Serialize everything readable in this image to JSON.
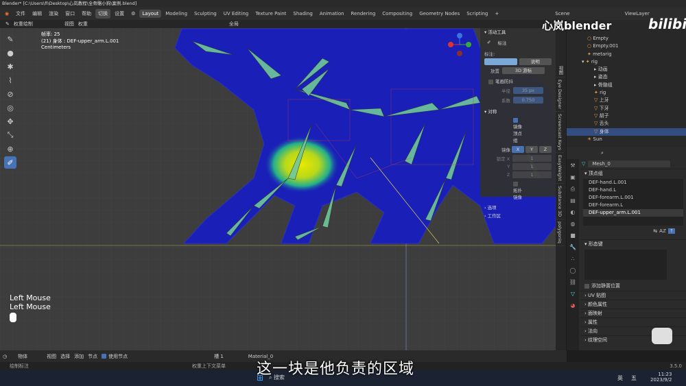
{
  "window": {
    "title": "Blender* [C:\\Users\\fi\\Desktop\\心岚教程\\全骨骼小狗\\案例.blend]"
  },
  "menu": {
    "items": [
      "文件",
      "编辑",
      "渲染",
      "窗口",
      "帮助"
    ],
    "mode_label": "切换",
    "settings": "设置"
  },
  "workspaces": [
    "Layout",
    "Modeling",
    "Sculpting",
    "UV Editing",
    "Texture Paint",
    "Shading",
    "Animation",
    "Rendering",
    "Compositing",
    "Geometry Nodes",
    "Scripting"
  ],
  "scene": "Scene",
  "view_layer": "ViewLayer",
  "viewport_header": {
    "mode": "权重绘制",
    "view": "视图",
    "weights": "权重",
    "orientation": "全局"
  },
  "viewport_info": {
    "fps": "帧率: 25",
    "object": "(21) 身体 : DEF-upper_arm.L.001",
    "units": "Centimeters"
  },
  "mouse": {
    "line1": "Left Mouse",
    "line2": "Left Mouse"
  },
  "npanel": {
    "active_tool": "活动工具",
    "tool_name": "标注",
    "annotation_label": "标注:",
    "note_label": "说明",
    "placement_label": "放置",
    "placement_value": "3D 游标",
    "stabilize": "笔画防抖",
    "radius_label": "半径",
    "radius_value": "35 px",
    "factor_label": "系数",
    "factor_value": "0.750",
    "symmetry": "对称",
    "mirror_vg": "镜像顶点组",
    "mirror_label": "镜像",
    "axes": [
      "X",
      "Y",
      "Z"
    ],
    "lock_label": "锁定 X",
    "lock_vals": [
      "1",
      "1",
      "1"
    ],
    "y_label": "Y",
    "z_label": "Z",
    "topo": "拓扑镜像",
    "options": "选项",
    "workspace": "工作区"
  },
  "vtabs": [
    "视图",
    "Eye Designer",
    "Screencast Keys",
    "EasyWeight",
    "Substance 3D",
    "polygoniq"
  ],
  "outliner": [
    {
      "name": "Empty",
      "icon": "○"
    },
    {
      "name": "Empty.001",
      "icon": "○"
    },
    {
      "name": "metarig",
      "icon": "✦"
    },
    {
      "name": "rig",
      "icon": "✦",
      "open": true
    },
    {
      "name": "动画",
      "icon": "▸"
    },
    {
      "name": "姿态",
      "icon": "▸"
    },
    {
      "name": "骨骼组",
      "icon": "▸"
    },
    {
      "name": "rig",
      "icon": "✦"
    },
    {
      "name": "上牙",
      "icon": "▽"
    },
    {
      "name": "下牙",
      "icon": "▽"
    },
    {
      "name": "胡子",
      "icon": "▽"
    },
    {
      "name": "舌头",
      "icon": "▽"
    },
    {
      "name": "身体",
      "icon": "▽",
      "sel": true
    },
    {
      "name": "Sun",
      "icon": "☀"
    }
  ],
  "props": {
    "mesh": "Mesh_0",
    "vertex_groups": "顶点组",
    "vg_items": [
      "DEF-hand.L.001",
      "DEF-hand.L",
      "DEF-forearm.L.001",
      "DEF-forearm.L",
      "DEF-upper_arm.L.001"
    ],
    "shape_keys": "形态键",
    "add_rest": "添加静置位置",
    "sections": [
      "UV 贴图",
      "颜色属性",
      "面映射",
      "属性",
      "法向",
      "纹理空间"
    ]
  },
  "bottombar": {
    "object_mode": "物体",
    "view": "视图",
    "select": "选择",
    "add": "添加",
    "node": "节点",
    "use_nodes": "使用节点",
    "slot": "槽 1",
    "material": "Material_0"
  },
  "status": {
    "left": "绘制标注",
    "mid": "权重上下文菜单",
    "version": "3.5.0"
  },
  "taskbar": {
    "search": "搜索",
    "time": "11:23",
    "date": "2023/9/2",
    "ime1": "英",
    "ime2": "五"
  },
  "subtitle": "这一块是他负责的区域",
  "watermark": "心岚blender",
  "bili": "bilibili",
  "colors": {
    "accent": "#4772b3",
    "selected": "#334d80",
    "mesh_blue": "#1a1fb8"
  }
}
